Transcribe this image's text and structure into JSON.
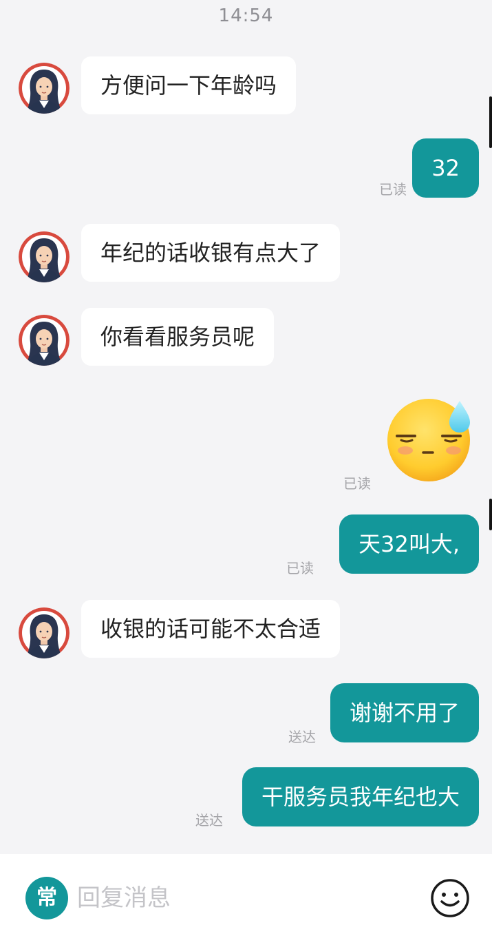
{
  "chat": {
    "timestamp": "14:54",
    "messages": [
      {
        "from": "other",
        "text": "方便问一下年龄吗"
      },
      {
        "from": "me",
        "text": "32",
        "status": "已读"
      },
      {
        "from": "other",
        "text": "年纪的话收银有点大了"
      },
      {
        "from": "other",
        "text": "你看看服务员呢"
      },
      {
        "from": "me",
        "sticker": "sweat-emoji",
        "status": "已读"
      },
      {
        "from": "me",
        "text": "天32叫大,",
        "status": "已读"
      },
      {
        "from": "other",
        "text": "收银的话可能不太合适"
      },
      {
        "from": "me",
        "text": "谢谢不用了",
        "status": "送达"
      },
      {
        "from": "me",
        "text": "干服务员我年纪也大",
        "status": "送达"
      }
    ]
  },
  "input_bar": {
    "quick_reply_label": "常",
    "placeholder": "回复消息",
    "emoji_icon": "smiley-icon"
  },
  "colors": {
    "outgoing_bubble": "#13979a",
    "incoming_bubble": "#ffffff",
    "background": "#f4f4f6",
    "avatar_ring": "#d84a3e"
  }
}
